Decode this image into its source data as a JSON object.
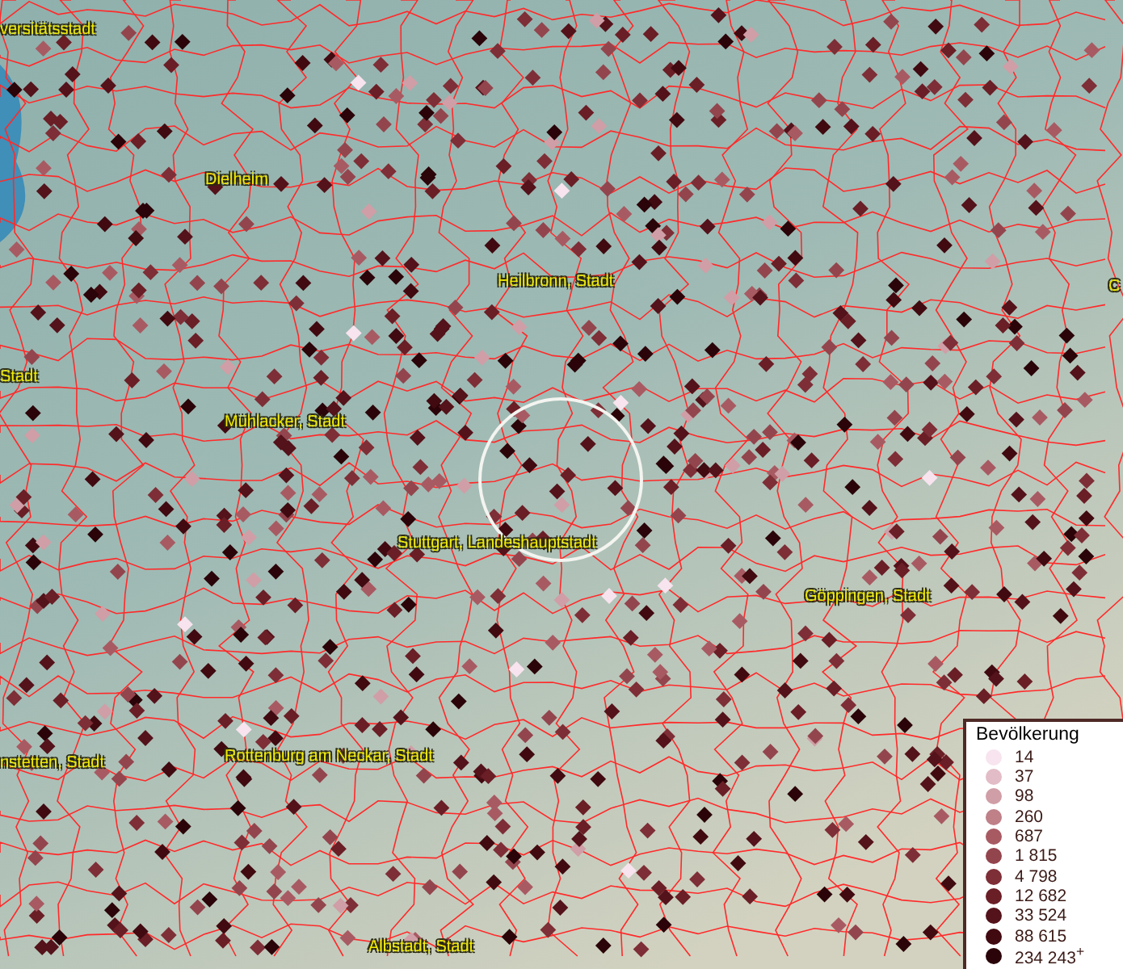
{
  "map": {
    "labels": [
      {
        "text": "versitätsstadt"
      },
      {
        "text": "Dielheim"
      },
      {
        "text": "Heilbronn, Stadt"
      },
      {
        "text": "C"
      },
      {
        "text": "Stadt"
      },
      {
        "text": "Mühlacker, Stadt"
      },
      {
        "text": "Stuttgart, Landeshauptstadt"
      },
      {
        "text": "Göppingen, Stadt"
      },
      {
        "text": "nstetten, Stadt"
      },
      {
        "text": "Rottenburg am Neckar, Stadt"
      },
      {
        "text": "Albstadt, Stadt"
      }
    ]
  },
  "legend": {
    "title": "Bevölkerung",
    "items": [
      {
        "label": "14",
        "color": "#f7e4ee"
      },
      {
        "label": "37",
        "color": "#e2bcc6"
      },
      {
        "label": "98",
        "color": "#d09ea6"
      },
      {
        "label": "260",
        "color": "#bf8088"
      },
      {
        "label": "687",
        "color": "#a85a62"
      },
      {
        "label": "1 815",
        "color": "#93454d"
      },
      {
        "label": "4 798",
        "color": "#7e2e36"
      },
      {
        "label": "12 682",
        "color": "#6a1e26"
      },
      {
        "label": "33 524",
        "color": "#54121a"
      },
      {
        "label": "88 615",
        "color": "#400a10"
      },
      {
        "label": "234 243$^{+}$",
        "color": "#2a0408"
      }
    ]
  }
}
